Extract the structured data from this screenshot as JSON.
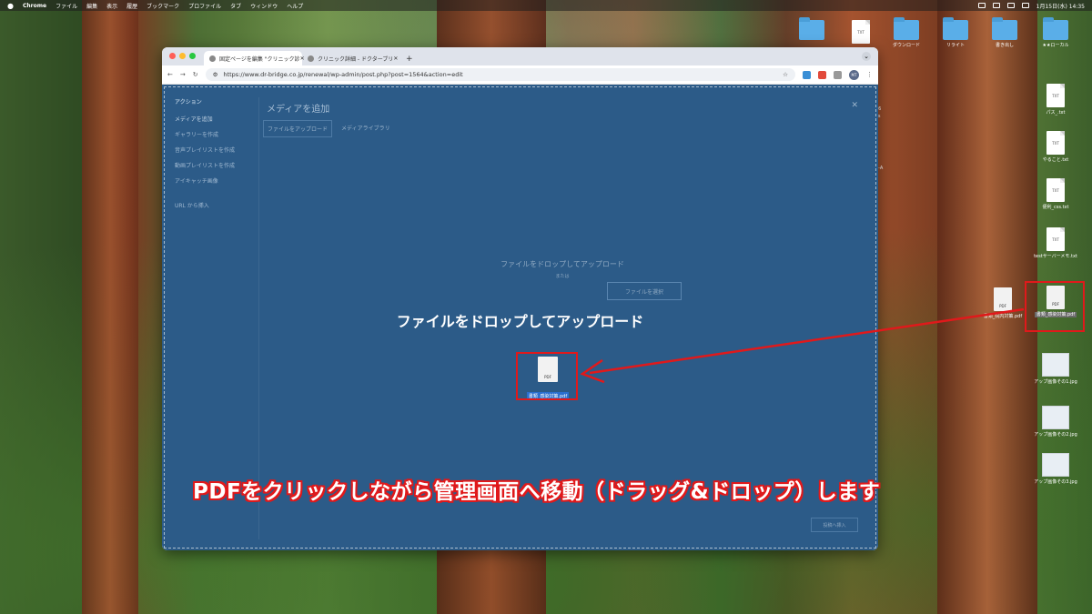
{
  "menubar": {
    "app": "Chrome",
    "items": [
      "ファイル",
      "編集",
      "表示",
      "履歴",
      "ブックマーク",
      "プロファイル",
      "タブ",
      "ウィンドウ",
      "ヘルプ"
    ],
    "clock": "1月15日(水) 14:35"
  },
  "desktop": {
    "top_folders": [
      "",
      "",
      "ダウンロード",
      "リライト",
      "書き出し",
      "★★ローカル"
    ],
    "files": [
      {
        "name": "パス_.txt",
        "kind": "txt"
      },
      {
        "name": "やること.txt",
        "kind": "txt"
      },
      {
        "name": "便利_css.txt",
        "kind": "txt"
      },
      {
        "name": "testサーバーメモ.txt",
        "kind": "txt"
      },
      {
        "name": "書類_院内対策.pdf",
        "kind": "pdf"
      },
      {
        "name": "書類_感染対策.pdf",
        "kind": "pdf"
      },
      {
        "name": "アップ画像その1.jpg",
        "kind": "img"
      },
      {
        "name": "アップ画像その2.jpg",
        "kind": "img"
      },
      {
        "name": "アップ画像その3.jpg",
        "kind": "img"
      }
    ],
    "side_text_1": "26",
    "side_text_2": "ks",
    "side_text_3": "8-A"
  },
  "browser": {
    "tabs": [
      {
        "label": "固定ページを編集 \"クリニック診"
      },
      {
        "label": "クリニック詳細 - ドクターブリ"
      }
    ],
    "url": "https://www.dr-bridge.co.jp/renewal/wp-admin/post.php?post=1564&action=edit",
    "profile": "MT"
  },
  "media_modal": {
    "sidebar_heading": "アクション",
    "sidebar_items": [
      "メディアを追加",
      "ギャラリーを作成",
      "音声プレイリストを作成",
      "動画プレイリストを作成",
      "アイキャッチ画像",
      "URL から挿入"
    ],
    "title": "メディアを追加",
    "tabs": [
      "ファイルをアップロード",
      "メディアライブラリ"
    ],
    "drop_hint": "ファイルをドロップしてアップロード",
    "drop_or": "または",
    "select_button": "ファイルを選択",
    "insert_button": "投稿へ挿入",
    "overlay_text": "ファイルをドロップしてアップロード",
    "dragged_file": "書類_感染対策.pdf"
  },
  "annotation": {
    "caption": "PDFをクリックしながら管理画面へ移動（ドラッグ&ドロップ）します",
    "color": "#e0191b"
  }
}
